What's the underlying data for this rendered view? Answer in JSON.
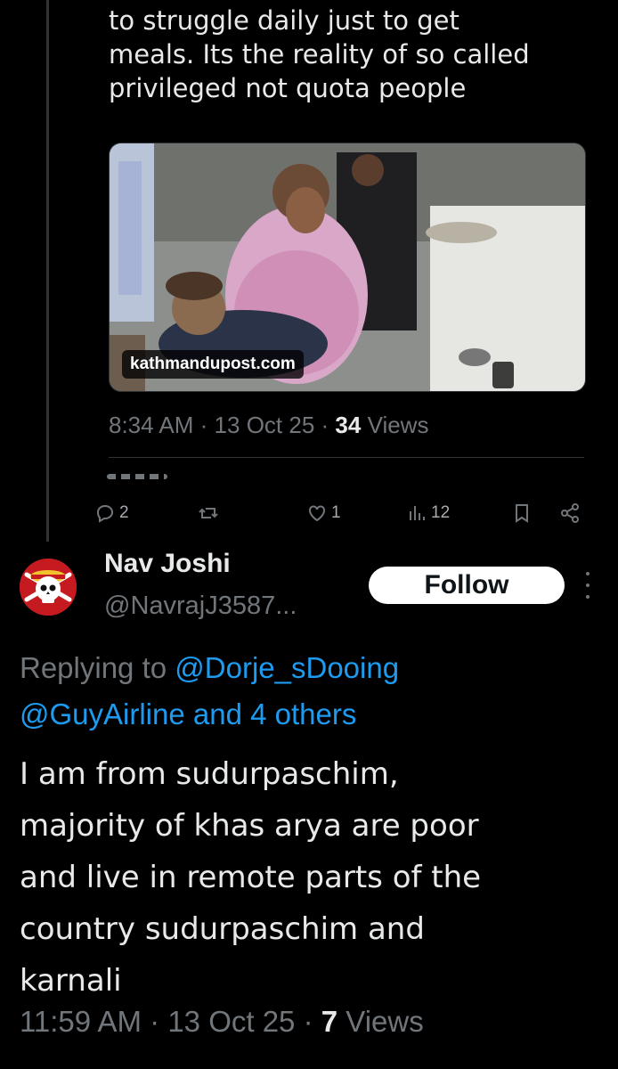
{
  "quoted_post": {
    "text_lines": [
      "to struggle daily just to get",
      "meals. Its the reality of so called",
      "privileged not quota people"
    ],
    "media": {
      "source_label": "kathmandupost.com"
    },
    "time": "8:34 AM",
    "separator": "·",
    "date": "13 Oct 25",
    "views_count": "34",
    "views_label": "Views",
    "actions": {
      "reply_count": "2",
      "repost_count": "",
      "like_count": "1",
      "views_count": "12"
    }
  },
  "reply": {
    "author": {
      "name": "Nav Joshi",
      "handle": "@NavrajJ3587..."
    },
    "follow_label": "Follow",
    "replying_to_label": "Replying to",
    "replying_mention_1": "@Dorje_sDooing",
    "replying_mention_2": "@GuyAirline and 4 others",
    "body_lines": [
      "I am from sudurpaschim,",
      "majority of khas arya are poor",
      "and live in remote parts of the",
      "country sudurpaschim and",
      "karnali"
    ],
    "time": "11:59 AM",
    "separator": "·",
    "date": "13 Oct 25",
    "views_count": "7",
    "views_label": "Views"
  },
  "icons": [
    "reply-icon",
    "repost-icon",
    "like-icon",
    "views-icon",
    "bookmark-icon",
    "share-icon",
    "more-icon",
    "pirate-skull-avatar"
  ],
  "colors": {
    "background": "#000000",
    "text": "#e7e9ea",
    "muted": "#71767b",
    "link": "#1d9bf0",
    "avatar_bg": "#c41a20"
  }
}
